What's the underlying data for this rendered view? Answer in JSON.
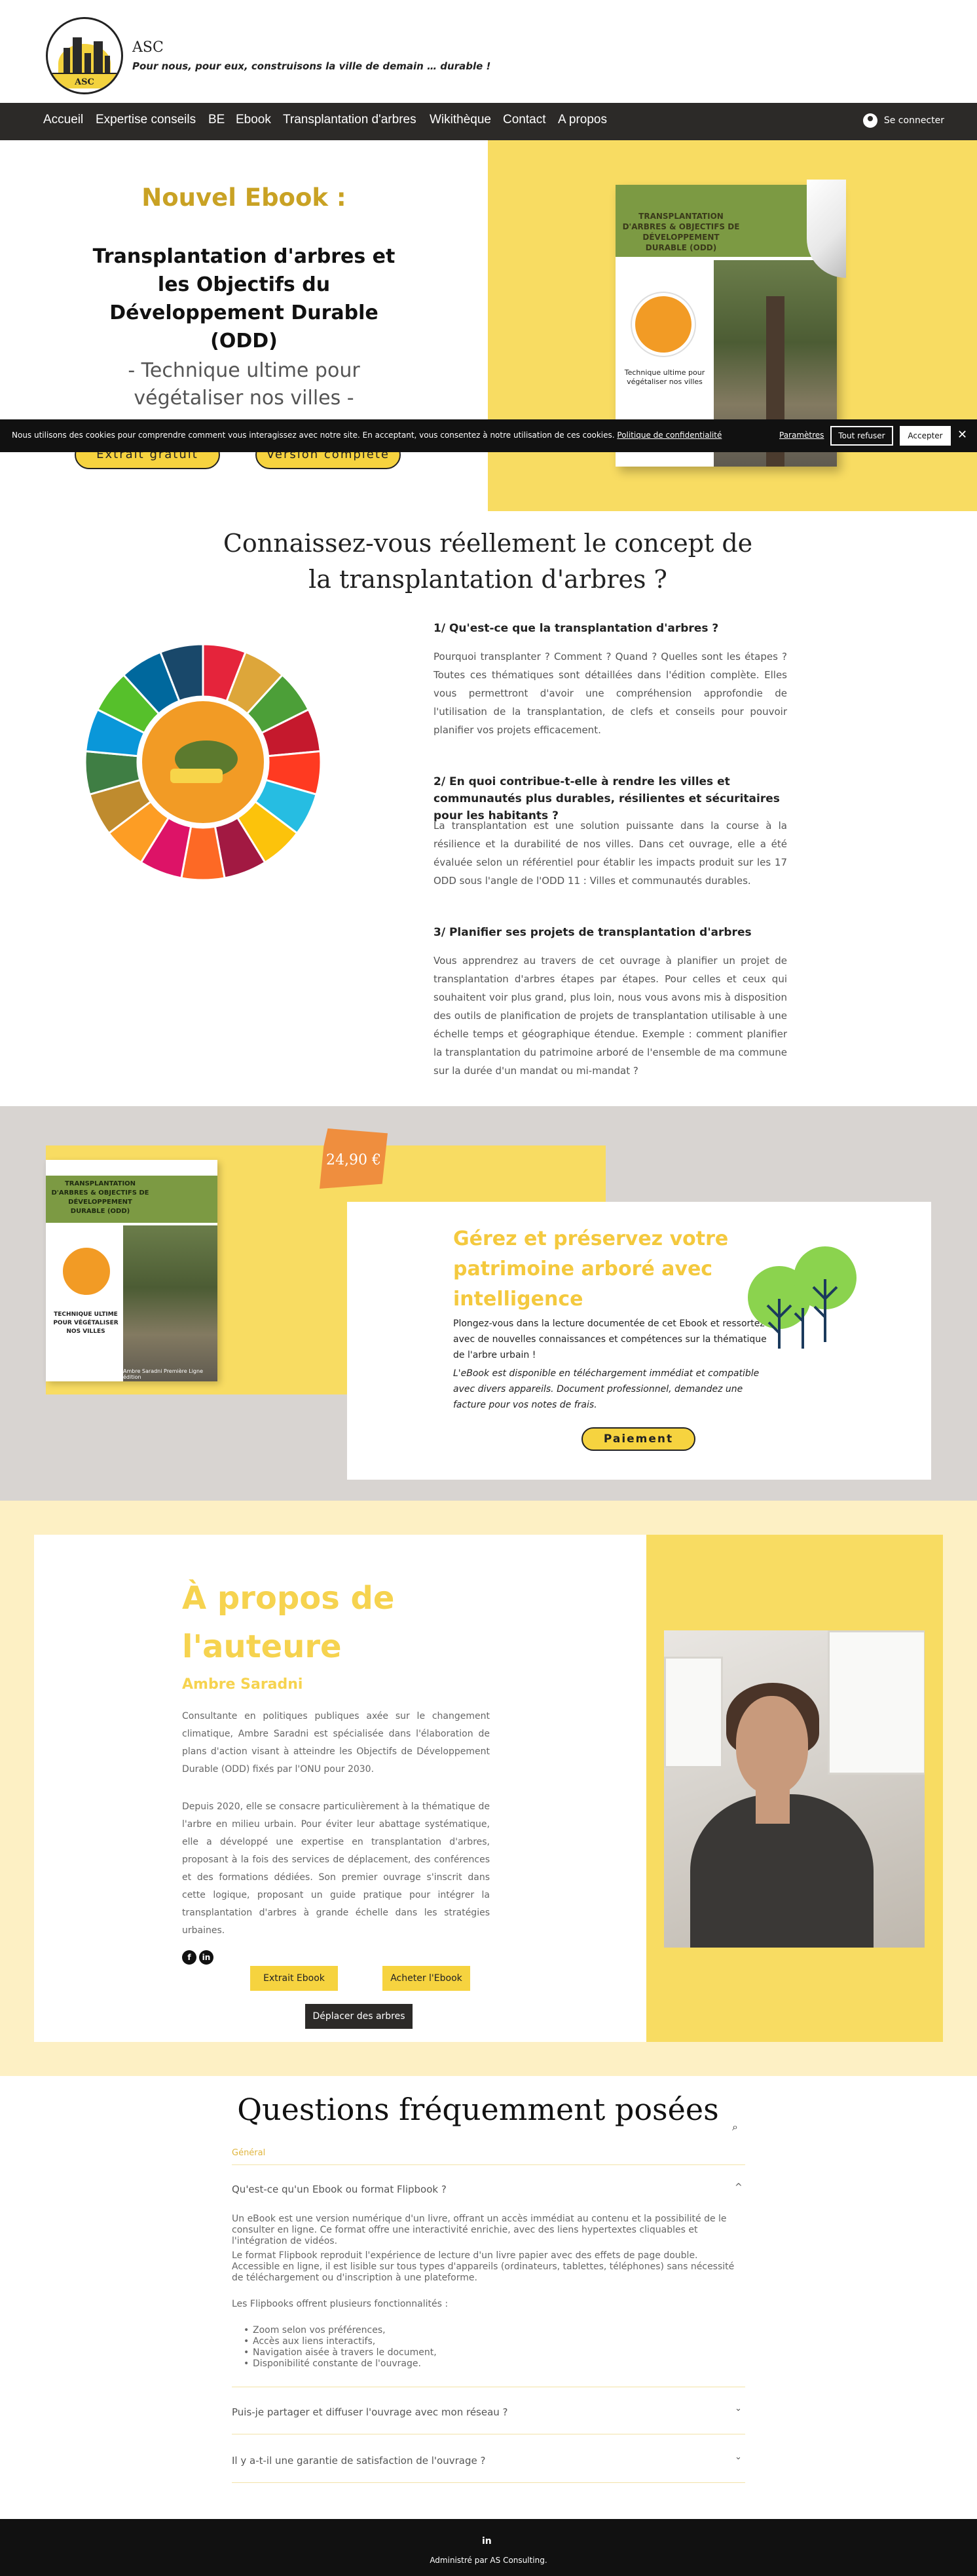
{
  "header": {
    "brand": "ASC",
    "logo_text": "ASC",
    "tagline": "Pour nous, pour eux, construisons la ville de demain … durable !"
  },
  "nav": {
    "items": [
      "Accueil",
      "Expertise conseils",
      "BE",
      "Ebook",
      "Transplantation d'arbres",
      "Wikithèque",
      "Contact",
      "A propos"
    ],
    "login": "Se connecter"
  },
  "hero": {
    "title": "Nouvel Ebook  :",
    "book_title": "Transplantation d'arbres et les Objectifs du Développement Durable (ODD)",
    "subtitle": "- Technique ultime pour végétaliser nos villes -",
    "btn_extract": "Extrait gratuit",
    "btn_full": "Version complète",
    "cover_title": "TRANSPLANTATION D'ARBRES & OBJECTIFS DE DÉVELOPPEMENT DURABLE (ODD)",
    "cover_caption": "Technique ultime pour végétaliser nos villes"
  },
  "cookie": {
    "text": "Nous utilisons des cookies pour comprendre comment vous interagissez avec notre site. En acceptant, vous consentez à notre utilisation de ces cookies.",
    "link": "Politique de confidentialité",
    "prefs": "Paramètres",
    "refuse": "Tout refuser",
    "accept": "Accepter",
    "close": "✕"
  },
  "concept": {
    "title_line1": "Connaissez-vous réellement le concept de",
    "title_line2": "la transplantation d'arbres ?",
    "q1_title": "1/ Qu'est-ce que la transplantation d'arbres ?",
    "q1_body": "Pourquoi transplanter ? Comment ? Quand ? Quelles sont les étapes ? Toutes ces thématiques sont détaillées dans l'édition complète. Elles vous permettront d'avoir une compréhension approfondie de l'utilisation de la transplantation, de clefs et conseils pour pouvoir planifier vos projets efficacement.",
    "q2_title": "2/ En quoi contribue-t-elle à rendre les villes et communautés plus durables, résilientes et sécuritaires pour les habitants ?",
    "q2_body": "La transplantation est une solution puissante dans la course à la résilience et la durabilité de nos villes. Dans cet ouvrage, elle a été évaluée selon un référentiel pour établir les impacts produit sur les 17 ODD sous l'angle de l'ODD 11 : Villes et communautés durables.",
    "q3_title": "3/ Planifier ses projets de transplantation d'arbres",
    "q3_body": "Vous apprendrez au travers de cet ouvrage à planifier un projet de transplantation d'arbres étapes par étapes. Pour celles et ceux qui souhaitent voir plus grand, plus loin, nous vous avons mis à disposition des outils de planification de projets de transplantation utilisable à une échelle temps et géographique étendue. Exemple : comment planifier la transplantation du patrimoine arboré de l'ensemble de ma commune sur la durée d'un mandat ou mi-mandat ?"
  },
  "sdg_colors": [
    "#e5243b",
    "#dda63a",
    "#4c9f38",
    "#c5192d",
    "#ff3a21",
    "#26bde2",
    "#fcc30b",
    "#a21942",
    "#fd6925",
    "#dd1367",
    "#fd9d24",
    "#bf8b2e",
    "#3f7e44",
    "#0a97d9",
    "#56c02b",
    "#00689d",
    "#19486a"
  ],
  "purchase": {
    "price": "24,90 €",
    "heading": "Gérez et préservez votre patrimoine arboré avec intelligence",
    "p1": "Plongez-vous dans la lecture documentée de cet Ebook et ressortez avec de nouvelles connaissances et compétences sur la thématique de l'arbre urbain !",
    "p2": "L'eBook est disponible en téléchargement immédiat et compatible avec divers appareils. Document professionnel, demandez une facture pour vos notes de frais.",
    "pay": "Paiement",
    "cover_title": "TRANSPLANTATION D'ARBRES & OBJECTIFS DE DÉVELOPPEMENT DURABLE (ODD)",
    "cover_caption": "TECHNIQUE ULTIME POUR VÉGÉTALISER NOS VILLES",
    "cover_footer": "Ambre Saradni    Première Ligne édition"
  },
  "author": {
    "heading": "À propos de l'auteure",
    "name": "Ambre Saradni",
    "p1": "Consultante en politiques publiques axée sur le changement climatique, Ambre Saradni est spécialisée dans l'élaboration de plans d'action visant à atteindre les Objectifs de Développement Durable (ODD) fixés par l'ONU pour 2030.",
    "p2": "Depuis 2020, elle se consacre particulièrement à la thématique de l'arbre en milieu urbain. Pour éviter leur abattage systématique, elle a développé une expertise en transplantation d'arbres, proposant à la fois des services de déplacement, des conférences et des formations dédiées. Son premier ouvrage s'inscrit dans cette logique, proposant un guide pratique pour intégrer la transplantation d'arbres à grande échelle dans les stratégies urbaines.",
    "fb": "f",
    "li": "in",
    "btn_extract": "Extrait Ebook",
    "btn_buy": "Acheter l'Ebook",
    "btn_move": "Déplacer des arbres"
  },
  "faq": {
    "title": "Questions fréquemment posées",
    "search_icon": "⌕",
    "category": "Général",
    "q1": "Qu'est-ce qu'un Ebook ou format Flipbook ?",
    "a1_p1": "Un eBook est une version numérique d'un livre, offrant un accès immédiat au contenu et la possibilité de le consulter en ligne. Ce format offre une interactivité enrichie, avec des liens hypertextes cliquables et l'intégration de vidéos.",
    "a1_p2": "Le format Flipbook reproduit l'expérience de lecture d'un livre papier avec des effets de page double. Accessible en ligne, il est lisible sur tous types d'appareils (ordinateurs, tablettes, téléphones) sans nécessité de téléchargement ou d'inscription à une plateforme.",
    "a1_p3": "Les Flipbooks offrent plusieurs fonctionnalités :",
    "a1_list": [
      "Zoom selon vos préférences,",
      "Accès aux liens interactifs,",
      "Navigation aisée à travers le document,",
      "Disponibilité constante de l'ouvrage."
    ],
    "q2": "Puis-je partager et diffuser l'ouvrage avec mon réseau ?",
    "q3": "Il y a-t-il une garantie de satisfaction de l'ouvrage ?",
    "chev_up": "^",
    "chev_down": "⌄"
  },
  "footer": {
    "li": "in",
    "text": "Administré par AS Consulting."
  }
}
